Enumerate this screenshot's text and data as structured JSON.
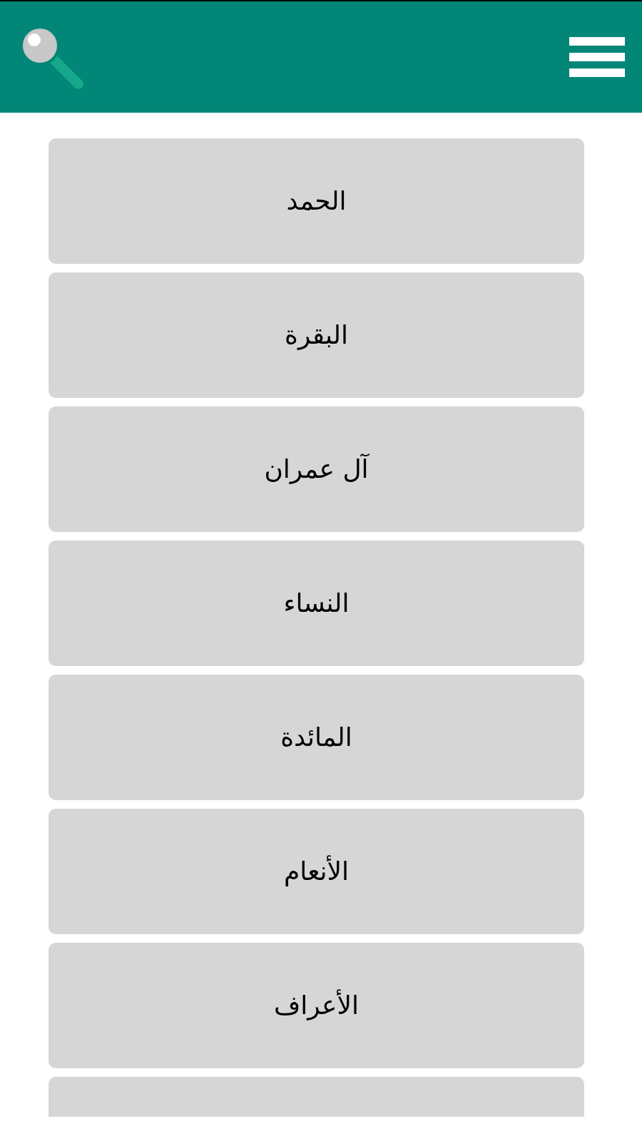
{
  "header": {
    "has_search": true,
    "has_menu": true
  },
  "surahs": [
    {
      "name": "الحمد"
    },
    {
      "name": "البقرة"
    },
    {
      "name": "آل عمران"
    },
    {
      "name": "النساء"
    },
    {
      "name": "المائدة"
    },
    {
      "name": "الأنعام"
    },
    {
      "name": "الأعراف"
    }
  ],
  "more_below": true
}
